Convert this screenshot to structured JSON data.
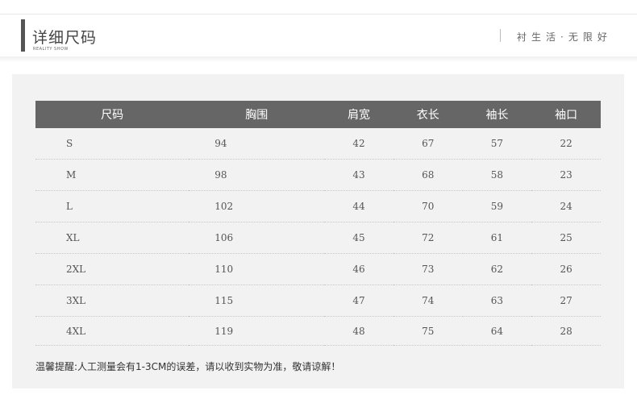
{
  "header": {
    "title": "详细尺码",
    "subtitle": "REALITY SHOW",
    "slogan": "衬生活·无限好"
  },
  "table": {
    "columns": [
      "尺码",
      "胸围",
      "肩宽",
      "衣长",
      "袖长",
      "袖口"
    ],
    "rows": [
      [
        "S",
        "94",
        "42",
        "67",
        "57",
        "22"
      ],
      [
        "M",
        "98",
        "43",
        "68",
        "58",
        "23"
      ],
      [
        "L",
        "102",
        "44",
        "70",
        "59",
        "24"
      ],
      [
        "XL",
        "106",
        "45",
        "72",
        "61",
        "25"
      ],
      [
        "2XL",
        "110",
        "46",
        "73",
        "62",
        "26"
      ],
      [
        "3XL",
        "115",
        "47",
        "74",
        "63",
        "27"
      ],
      [
        "4XL",
        "119",
        "48",
        "75",
        "64",
        "28"
      ]
    ]
  },
  "note": "温馨提醒:人工测量会有1-3CM的误差，请以收到实物为准，敬请谅解！"
}
